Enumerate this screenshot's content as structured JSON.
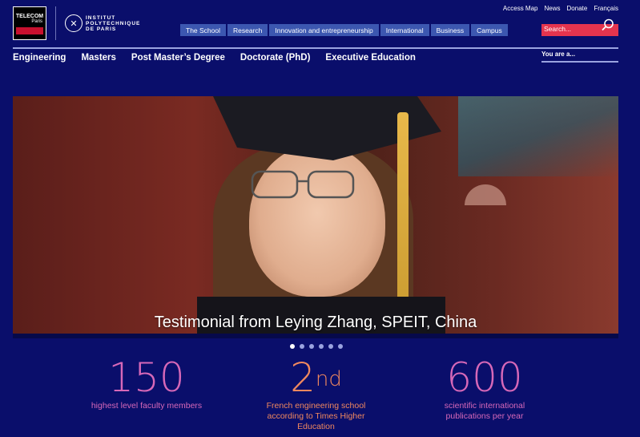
{
  "logo": {
    "telecom_line1": "TELECOM",
    "telecom_line2": "Paris",
    "ip_line1": "INSTITUT",
    "ip_line2": "POLYTECHNIQUE",
    "ip_line3": "DE PARIS"
  },
  "top_links": [
    "Access Map",
    "News",
    "Donate",
    "Français"
  ],
  "main_nav": [
    "The School",
    "Research",
    "Innovation and entrepreneurship",
    "International",
    "Business",
    "Campus"
  ],
  "search": {
    "placeholder": "Search..."
  },
  "sub_nav": [
    "Engineering",
    "Masters",
    "Post Master’s Degree",
    "Doctorate (PhD)",
    "Executive Education"
  ],
  "you_are": "You are a...",
  "hero": {
    "caption": "Testimonial from Leying Zhang, SPEIT, China"
  },
  "carousel": {
    "count": 6,
    "active": 0
  },
  "stats": [
    {
      "number": "150",
      "suffix": "",
      "label": "highest level faculty members"
    },
    {
      "number": "2",
      "suffix": "nd",
      "label": "French engineering school according to Times Higher Education"
    },
    {
      "number": "600",
      "suffix": "",
      "label": "scientific international publications per year"
    }
  ],
  "colors": {
    "background": "#0a0e6b",
    "nav_button": "#3c57b0",
    "search_bg": "#e5344e",
    "stat_pink": "#d768b8",
    "stat_orange": "#f0885e"
  }
}
